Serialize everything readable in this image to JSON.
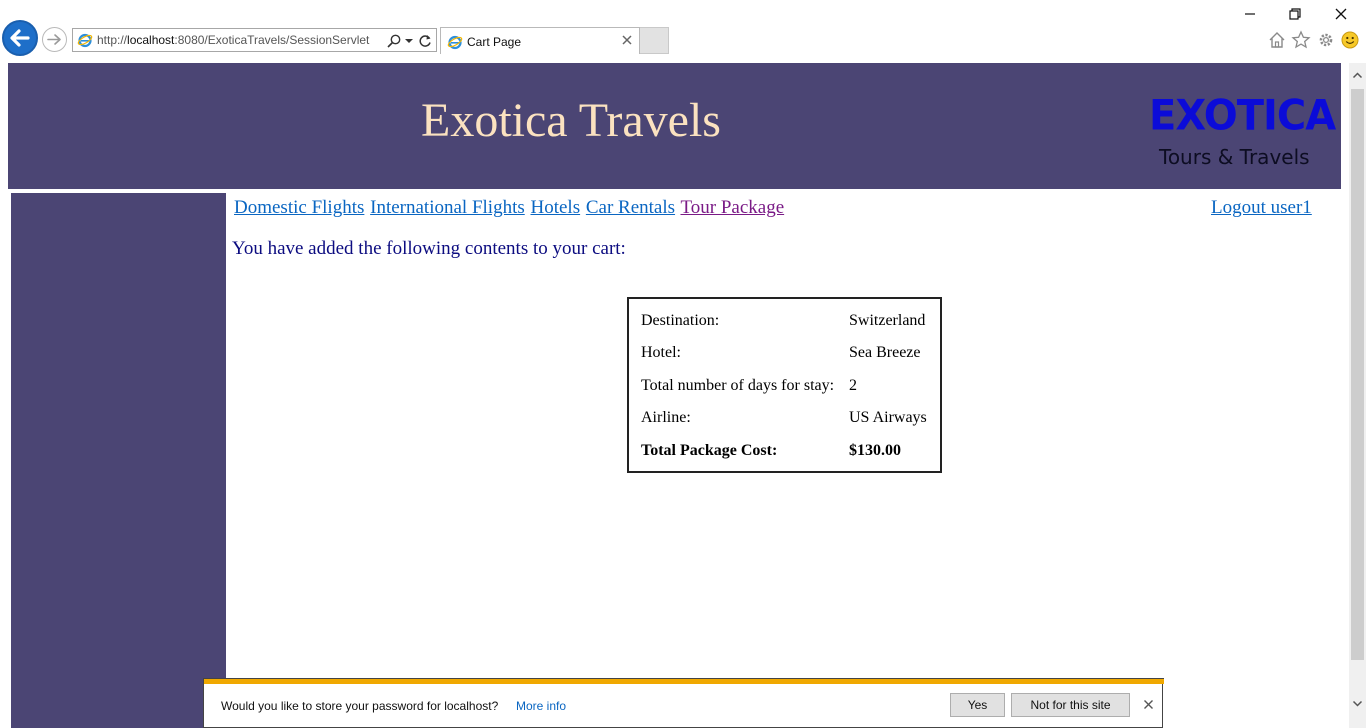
{
  "browser": {
    "url_prefix": "http://",
    "url_host": "localhost",
    "url_rest": ":8080/ExoticaTravels/SessionServlet",
    "tab_title": "Cart Page",
    "icons": [
      "back-arrow-icon",
      "forward-arrow-icon",
      "ie-logo-icon",
      "search-icon",
      "chevron-down-icon",
      "refresh-icon",
      "close-icon",
      "minimize-icon",
      "restore-icon",
      "home-icon",
      "favorites-star-icon",
      "gear-icon",
      "smiley-feedback-icon"
    ]
  },
  "header": {
    "title": "Exotica Travels",
    "logo_word": "EXOTICA",
    "logo_tagline": "Tours & Travels",
    "banner_color": "#4b4574"
  },
  "nav": {
    "links": [
      "Domestic Flights",
      "International Flights",
      "Hotels",
      "Car Rentals",
      "Tour Package"
    ],
    "logout": "Logout user1"
  },
  "cart": {
    "message": "You have added the following contents to your cart:",
    "rows": [
      {
        "label": "Destination:",
        "value": "Switzerland"
      },
      {
        "label": "Hotel:",
        "value": "Sea Breeze"
      },
      {
        "label": "Total number of days for stay:",
        "value": "2"
      },
      {
        "label": "Airline:",
        "value": "US Airways"
      },
      {
        "label": "Total Package Cost:",
        "value": "$130.00"
      }
    ]
  },
  "notification": {
    "text": "Would you like to store your password for localhost?",
    "more_info": "More info",
    "yes_label": "Yes",
    "no_label": "Not for this site"
  }
}
